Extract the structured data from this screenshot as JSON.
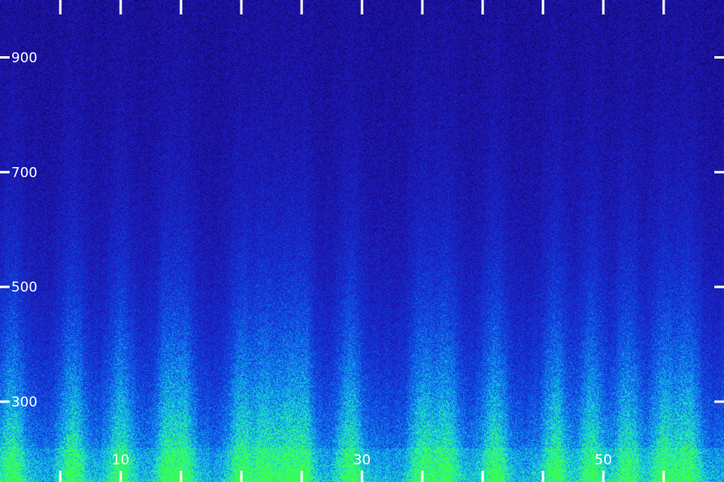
{
  "chart_data": {
    "type": "heatmap",
    "title": "",
    "xlabel": "",
    "ylabel": "",
    "x_tick_labels": [
      "10",
      "30",
      "50"
    ],
    "x_labeled_ticks": [
      10,
      30,
      50
    ],
    "x_ticks_all": [
      5,
      10,
      15,
      20,
      25,
      30,
      35,
      40,
      45,
      50,
      55
    ],
    "xlim": [
      0,
      60
    ],
    "y_tick_labels": [
      "300",
      "500",
      "700",
      "900"
    ],
    "y_ticks": [
      300,
      500,
      700,
      900
    ],
    "ylim": [
      160,
      1000
    ],
    "grid": false,
    "colormap": [
      "#050028",
      "#1f10a8",
      "#1040e0",
      "#10a0f0",
      "#20f0c0",
      "#40ff40"
    ],
    "axis_color": "#ffffff",
    "intensity_profile": {
      "x_hotspots": [
        1,
        6,
        10,
        14,
        15,
        20,
        22,
        24,
        25,
        29,
        35,
        37,
        41,
        46,
        49,
        52,
        55,
        57
      ],
      "description_levels": "energy concentrated below 500, fading toward 900"
    }
  }
}
